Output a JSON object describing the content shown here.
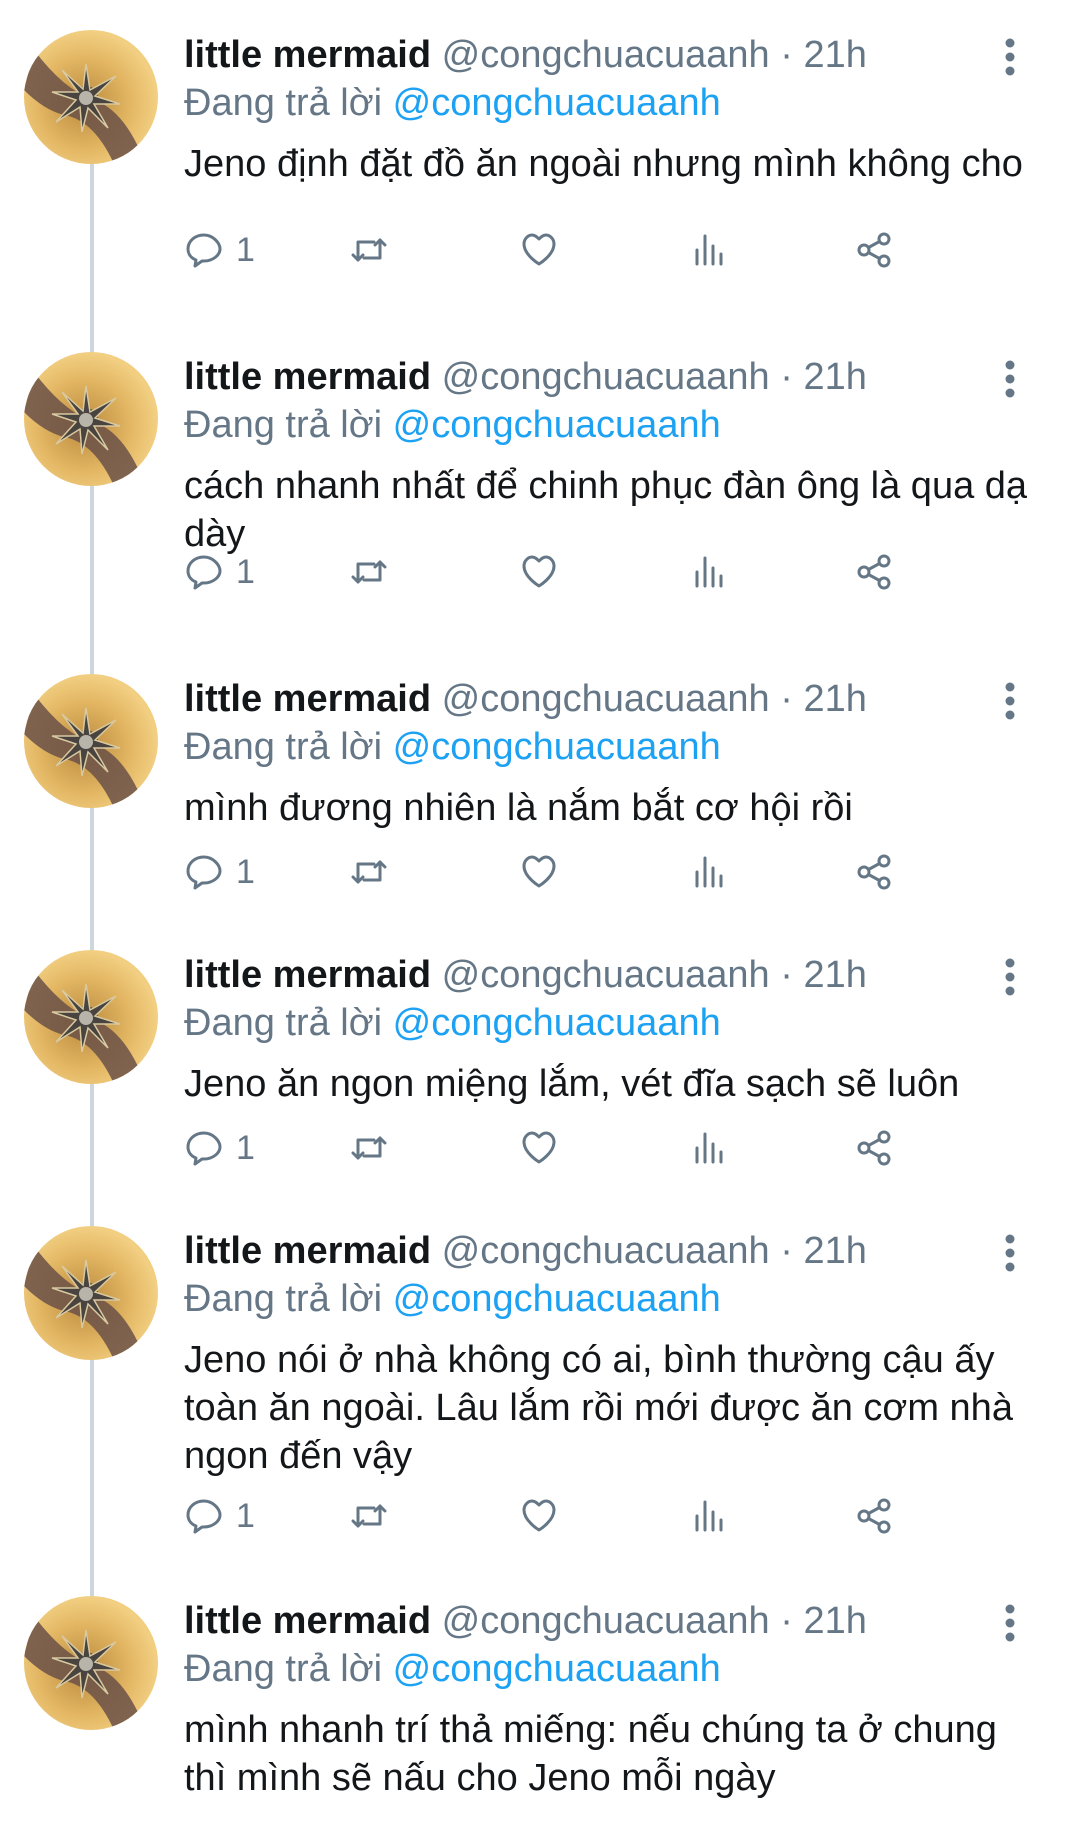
{
  "tweets": [
    {
      "name": "little mermaid",
      "handle": "@congchuacuaanh",
      "separator": "·",
      "time": "21h",
      "replying_prefix": "Đang trả lời",
      "replying_to": "@congchuacuaanh",
      "text": "Jeno định đặt đồ ăn ngoài nhưng mình không cho",
      "reply_count": "1"
    },
    {
      "name": "little mermaid",
      "handle": "@congchuacuaanh",
      "separator": "·",
      "time": "21h",
      "replying_prefix": "Đang trả lời",
      "replying_to": "@congchuacuaanh",
      "text": "cách nhanh nhất để chinh phục đàn ông là qua dạ dày",
      "reply_count": "1"
    },
    {
      "name": "little mermaid",
      "handle": "@congchuacuaanh",
      "separator": "·",
      "time": "21h",
      "replying_prefix": "Đang trả lời",
      "replying_to": "@congchuacuaanh",
      "text": "mình đương nhiên là nắm bắt cơ hội rồi",
      "reply_count": "1"
    },
    {
      "name": "little mermaid",
      "handle": "@congchuacuaanh",
      "separator": "·",
      "time": "21h",
      "replying_prefix": "Đang trả lời",
      "replying_to": "@congchuacuaanh",
      "text": "Jeno ăn ngon miệng lắm, vét đĩa sạch sẽ luôn",
      "reply_count": "1"
    },
    {
      "name": "little mermaid",
      "handle": "@congchuacuaanh",
      "separator": "·",
      "time": "21h",
      "replying_prefix": "Đang trả lời",
      "replying_to": "@congchuacuaanh",
      "text": "Jeno nói ở nhà không có ai, bình thường cậu ấy toàn ăn ngoài. Lâu lắm rồi mới được ăn cơm nhà ngon đến vậy",
      "reply_count": "1"
    },
    {
      "name": "little mermaid",
      "handle": "@congchuacuaanh",
      "separator": "·",
      "time": "21h",
      "replying_prefix": "Đang trả lời",
      "replying_to": "@congchuacuaanh",
      "text": "mình nhanh trí thả miếng: nếu chúng ta ở chung thì mình sẽ nấu cho Jeno mỗi ngày",
      "reply_count": ""
    }
  ],
  "icons": {
    "reply": "reply-icon",
    "retweet": "retweet-icon",
    "like": "heart-icon",
    "analytics": "analytics-icon",
    "share": "share-icon",
    "more": "more-vertical-icon"
  },
  "colors": {
    "text": "#14171a",
    "secondary": "#657786",
    "link": "#1da1f2",
    "thread_line": "#ccd6dd"
  }
}
